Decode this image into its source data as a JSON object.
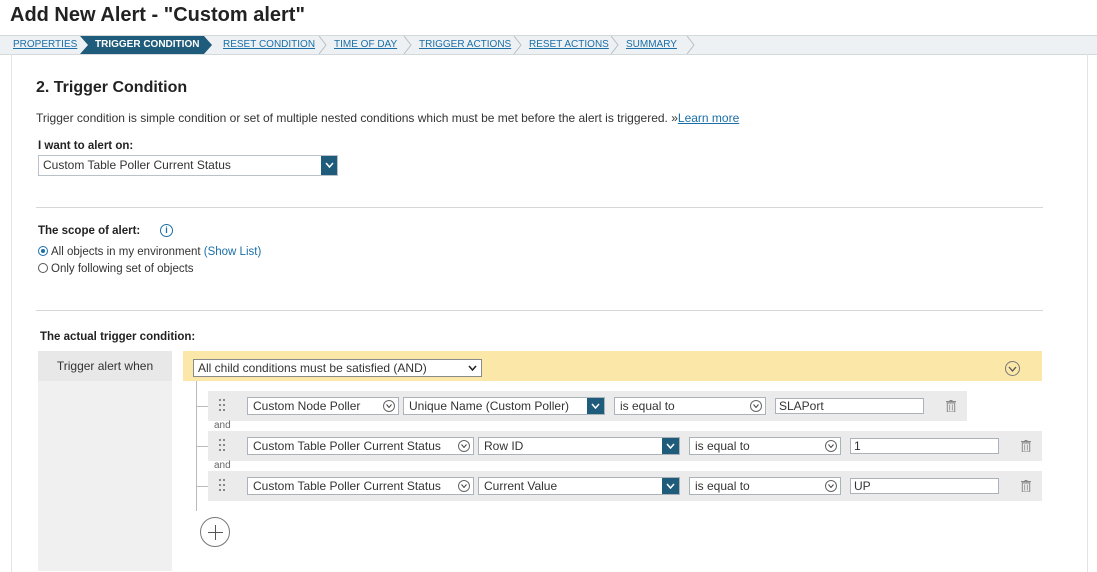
{
  "page": {
    "title": "Add New Alert - \"Custom alert\""
  },
  "wizard": {
    "steps": [
      {
        "label": "PROPERTIES",
        "active": false
      },
      {
        "label": "TRIGGER CONDITION",
        "active": true
      },
      {
        "label": "RESET CONDITION",
        "active": false
      },
      {
        "label": "TIME OF DAY",
        "active": false
      },
      {
        "label": "TRIGGER ACTIONS",
        "active": false
      },
      {
        "label": "RESET ACTIONS",
        "active": false
      },
      {
        "label": "SUMMARY",
        "active": false
      }
    ]
  },
  "section": {
    "title": "2. Trigger Condition",
    "description": "Trigger condition is simple condition or set of multiple nested conditions which must be met before the alert is triggered. »",
    "learn_more": "Learn more"
  },
  "alert_on": {
    "label": "I want to alert on:",
    "value": "Custom Table Poller Current Status"
  },
  "scope": {
    "label": "The scope of alert:",
    "options": [
      {
        "label": "All objects in my environment",
        "link": "(Show List)",
        "selected": true
      },
      {
        "label": "Only following set of objects",
        "selected": false
      }
    ]
  },
  "trigger": {
    "label": "The actual trigger condition:",
    "when_label": "Trigger alert when",
    "group_operator": "All child conditions must be satisfied (AND)",
    "joiner": "and",
    "conditions": [
      {
        "object": "Custom Node Poller",
        "field": "Unique Name (Custom Poller)",
        "operator": "is equal to",
        "value": "SLAPort"
      },
      {
        "object": "Custom Table Poller Current Status",
        "field": "Row ID",
        "operator": "is equal to",
        "value": "1"
      },
      {
        "object": "Custom Table Poller Current Status",
        "field": "Current Value",
        "operator": "is equal to",
        "value": "UP"
      }
    ]
  },
  "icons": {
    "info": "info-icon",
    "trash": "trash-icon",
    "add": "plus-circle-icon",
    "drag": "drag-handle-icon",
    "dropdown": "chevron-down-icon"
  },
  "colors": {
    "accent": "#1f5b7a",
    "link": "#1a6fa8",
    "group_bar": "#fbe7a8"
  }
}
